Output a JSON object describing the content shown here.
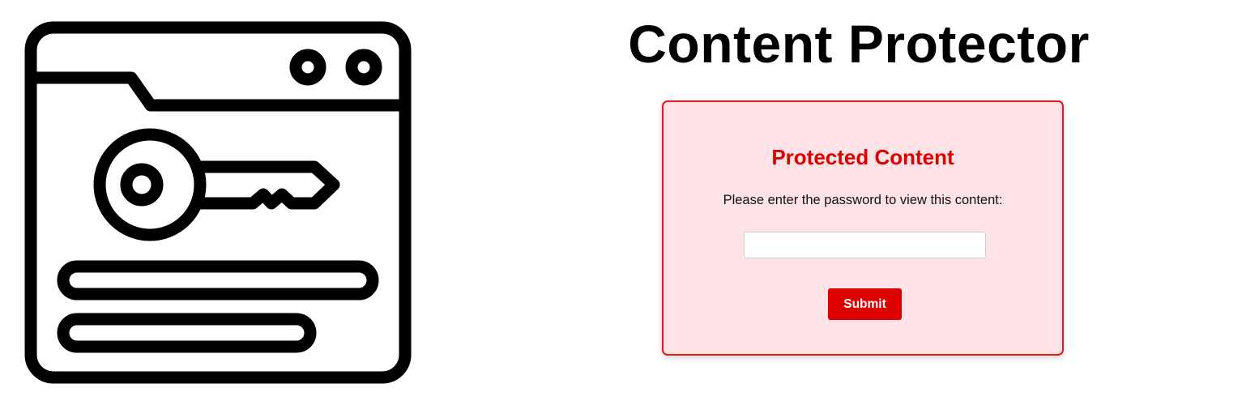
{
  "header": {
    "title": "Content Protector"
  },
  "illustration": {
    "icon": "browser-window-key-icon"
  },
  "protect_form": {
    "heading": "Protected Content",
    "instructions": "Please enter the password to view this content:",
    "password_value": "",
    "submit_label": "Submit"
  },
  "colors": {
    "accent": "#dd0000",
    "card_border": "#e61919",
    "card_background": "#ffe3e6",
    "title_text": "#000000"
  }
}
